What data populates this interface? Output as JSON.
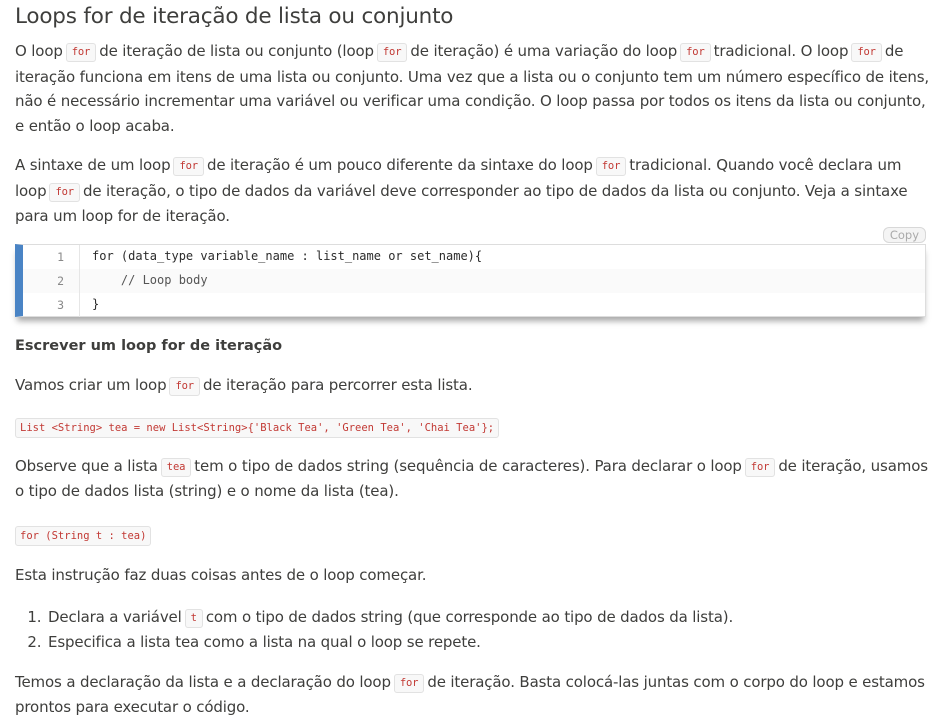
{
  "title": "Loops for de iteração de lista ou conjunto",
  "para1": {
    "t1": "O loop",
    "c1": "for",
    "t2": "de iteração de lista ou conjunto (loop",
    "c2": "for",
    "t3": "de iteração) é uma variação do loop",
    "c3": "for",
    "t4": "tradicional. O loop",
    "c4": "for",
    "t5": "de iteração funciona em itens de uma lista ou conjunto. Uma vez que a lista ou o conjunto tem um número específico de itens, não é necessário incrementar uma variável ou verificar uma condição. O loop passa por todos os itens da lista ou conjunto, e então o loop acaba."
  },
  "para2": {
    "t1": "A sintaxe de um loop",
    "c1": "for",
    "t2": "de iteração é um pouco diferente da sintaxe do loop",
    "c2": "for",
    "t3": "tradicional. Quando você declara um loop",
    "c3": "for",
    "t4": "de iteração, o tipo de dados da variável deve corresponder ao tipo de dados da lista ou conjunto. Veja a sintaxe para um loop for de iteração."
  },
  "codeblock": {
    "copy_label": "Copy",
    "lines": [
      {
        "num": "1",
        "text": "for (data_type variable_name : list_name or set_name){"
      },
      {
        "num": "2",
        "text": "    // Loop body"
      },
      {
        "num": "3",
        "text": "}"
      }
    ]
  },
  "subheading": "Escrever um loop for de iteração",
  "para3": {
    "t1": "Vamos criar um loop",
    "c1": "for",
    "t2": "de iteração para percorrer esta lista."
  },
  "snippet1": "List <String> tea = new List<String>{'Black Tea', 'Green Tea', 'Chai Tea'};",
  "para4": {
    "t1": "Observe que a lista",
    "c1": "tea",
    "t2": "tem o tipo de dados string (sequência de caracteres). Para declarar o loop",
    "c2": "for",
    "t3": "de iteração, usamos o tipo de dados lista (string) e o nome da lista (tea)."
  },
  "snippet2": "for (String t : tea)",
  "para5": "Esta instrução faz duas coisas antes de o loop começar.",
  "list": {
    "item1": {
      "t1": "Declara a variável",
      "c1": "t",
      "t2": "com o tipo de dados string (que corresponde ao tipo de dados da lista)."
    },
    "item2": "Especifica a lista tea como a lista na qual o loop se repete."
  },
  "para6": {
    "t1": "Temos a declaração da lista e a declaração do loop",
    "c1": "for",
    "t2": "de iteração. Basta colocá-las juntas com o corpo do loop e estamos prontos para executar o código."
  },
  "colors": {
    "text": "#3e3e3c",
    "code_red": "#c23934",
    "accent_blue": "#4a84c5"
  }
}
